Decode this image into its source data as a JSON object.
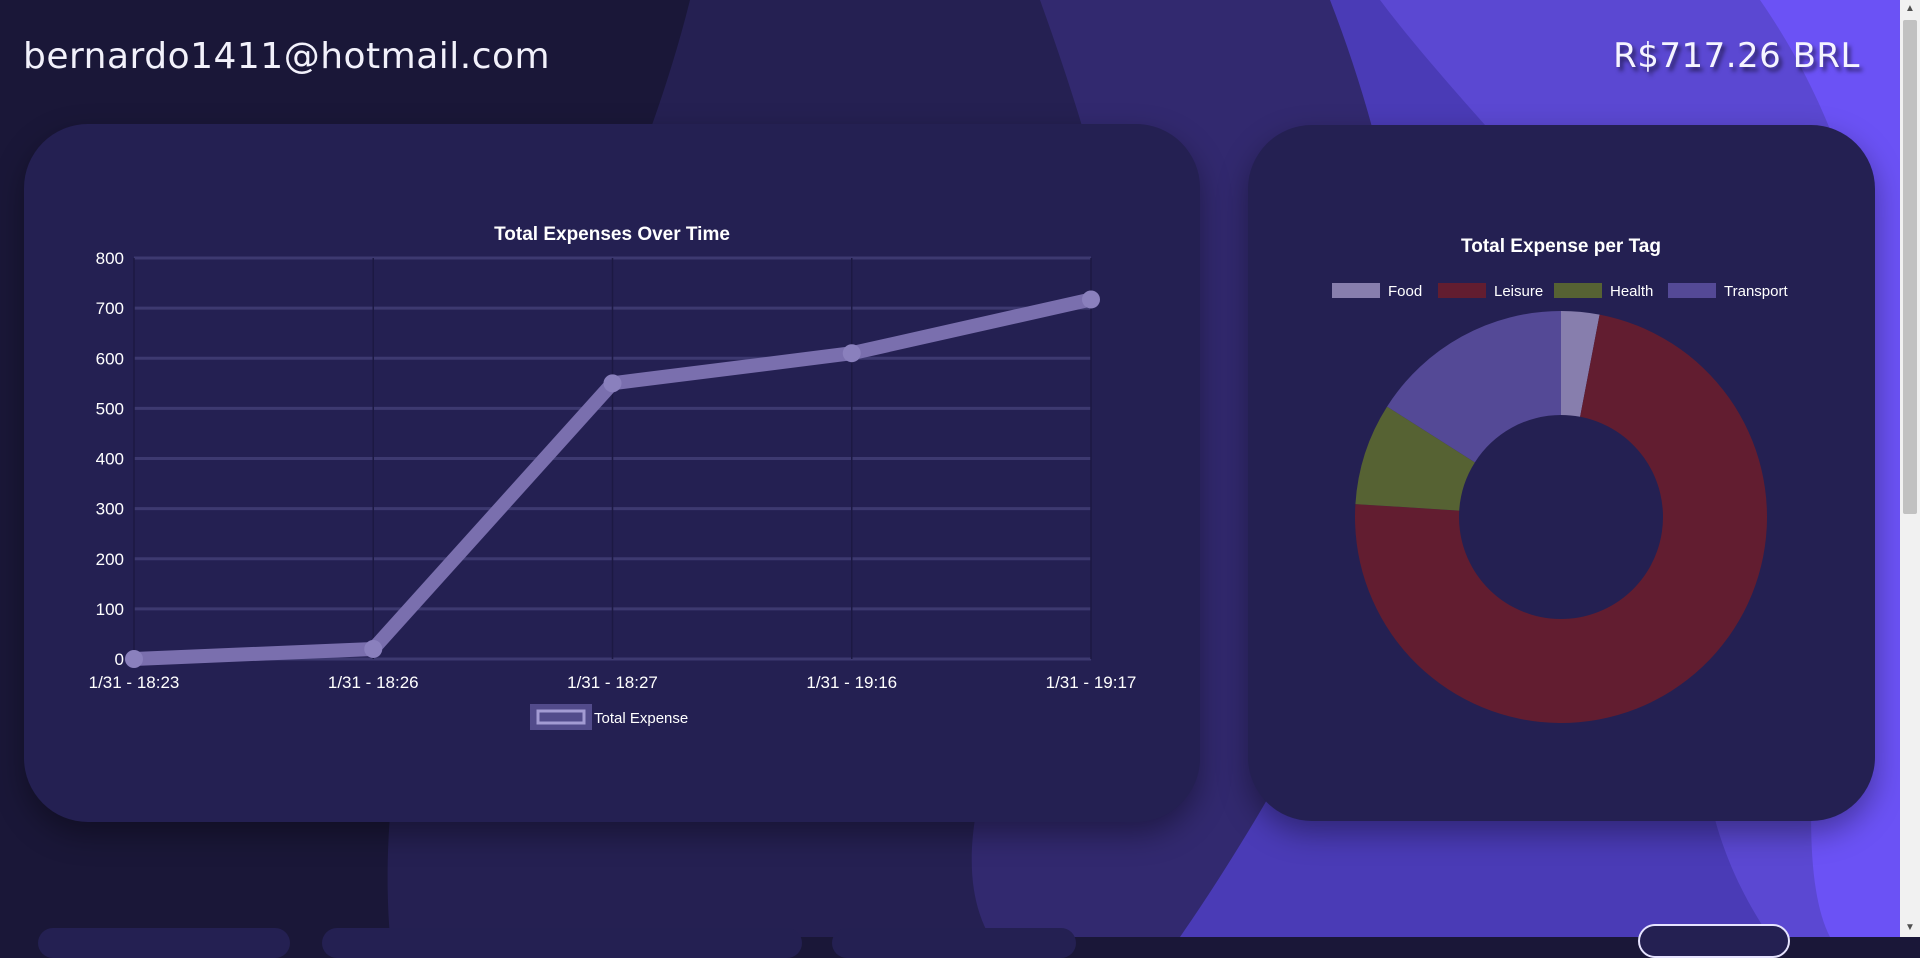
{
  "header": {
    "email": "bernardo1411@hotmail.com",
    "balance": "R$717.26 BRL"
  },
  "colors": {
    "page_dark": "#1a1738",
    "card": "#242052",
    "wave_mid": "#32296f",
    "wave_bright": "#5544c8",
    "accent_bright": "#6b52f5"
  },
  "chart_data": [
    {
      "type": "line",
      "title": "Total Expenses Over Time",
      "x": [
        "1/31 - 18:23",
        "1/31 - 18:26",
        "1/31 - 18:27",
        "1/31 - 19:16",
        "1/31 - 19:17"
      ],
      "series": [
        {
          "name": "Total Expense",
          "values": [
            0,
            20,
            550,
            610,
            717.26
          ],
          "color": "#7a6fae"
        }
      ],
      "ylim": [
        0,
        800
      ],
      "yticks": [
        0,
        100,
        200,
        300,
        400,
        500,
        600,
        700,
        800
      ],
      "grid": true,
      "legend": "bottom"
    },
    {
      "type": "pie",
      "variant": "doughnut",
      "title": "Total Expense per Tag",
      "categories": [
        "Food",
        "Leisure",
        "Health",
        "Transport"
      ],
      "values": [
        3,
        73,
        8,
        16
      ],
      "colors": [
        "#877ead",
        "#621d30",
        "#566233",
        "#544996"
      ],
      "legend": "top"
    }
  ],
  "bottom_controls": [
    "",
    "",
    "",
    ""
  ]
}
